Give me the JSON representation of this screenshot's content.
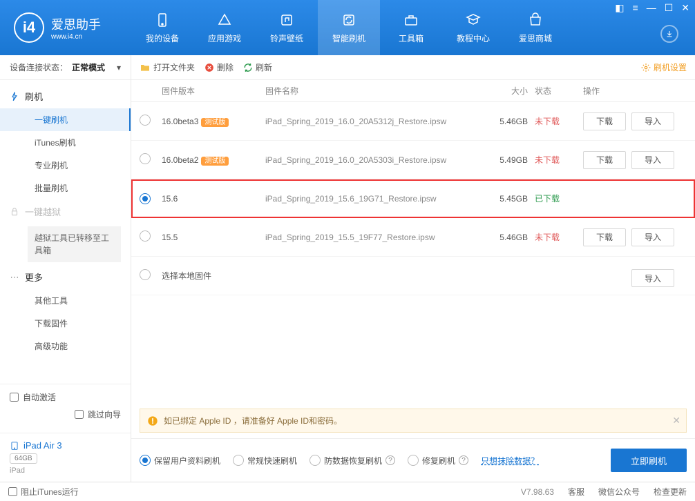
{
  "app": {
    "name": "爱思助手",
    "url": "www.i4.cn"
  },
  "nav": {
    "items": [
      {
        "label": "我的设备"
      },
      {
        "label": "应用游戏"
      },
      {
        "label": "铃声壁纸"
      },
      {
        "label": "智能刷机"
      },
      {
        "label": "工具箱"
      },
      {
        "label": "教程中心"
      },
      {
        "label": "爱思商城"
      }
    ]
  },
  "conn": {
    "label": "设备连接状态：",
    "mode": "正常模式"
  },
  "sidebar": {
    "group_flash": "刷机",
    "items": [
      "一键刷机",
      "iTunes刷机",
      "专业刷机",
      "批量刷机"
    ],
    "group_jb": "一键越狱",
    "jb_note": "越狱工具已转移至工具箱",
    "group_more": "更多",
    "more_items": [
      "其他工具",
      "下载固件",
      "高级功能"
    ],
    "auto_activate": "自动激活",
    "skip_guide": "跳过向导"
  },
  "device": {
    "name": "iPad Air 3",
    "capacity": "64GB",
    "type": "iPad"
  },
  "toolbar": {
    "open": "打开文件夹",
    "delete": "删除",
    "refresh": "刷新",
    "settings": "刷机设置"
  },
  "table": {
    "headers": {
      "ver": "固件版本",
      "name": "固件名称",
      "size": "大小",
      "status": "状态",
      "ops": "操作"
    },
    "download": "下载",
    "import": "导入",
    "rows": [
      {
        "ver": "16.0beta3",
        "beta": "测试版",
        "name": "iPad_Spring_2019_16.0_20A5312j_Restore.ipsw",
        "size": "5.46GB",
        "status": "未下载",
        "sel": false,
        "ops": true
      },
      {
        "ver": "16.0beta2",
        "beta": "测试版",
        "name": "iPad_Spring_2019_16.0_20A5303i_Restore.ipsw",
        "size": "5.49GB",
        "status": "未下载",
        "sel": false,
        "ops": true
      },
      {
        "ver": "15.6",
        "beta": "",
        "name": "iPad_Spring_2019_15.6_19G71_Restore.ipsw",
        "size": "5.45GB",
        "status": "已下载",
        "sel": true,
        "ops": false
      },
      {
        "ver": "15.5",
        "beta": "",
        "name": "iPad_Spring_2019_15.5_19F77_Restore.ipsw",
        "size": "5.46GB",
        "status": "未下载",
        "sel": false,
        "ops": true
      }
    ],
    "local_fw": "选择本地固件"
  },
  "notice": "如已绑定 Apple ID ，请准备好 Apple ID和密码。",
  "flash": {
    "opts": [
      "保留用户资料刷机",
      "常规快速刷机",
      "防数据恢复刷机",
      "修复刷机"
    ],
    "link": "只想抹除数据？",
    "btn": "立即刷机"
  },
  "footer": {
    "block_itunes": "阻止iTunes运行",
    "version": "V7.98.63",
    "links": [
      "客服",
      "微信公众号",
      "检查更新"
    ]
  }
}
